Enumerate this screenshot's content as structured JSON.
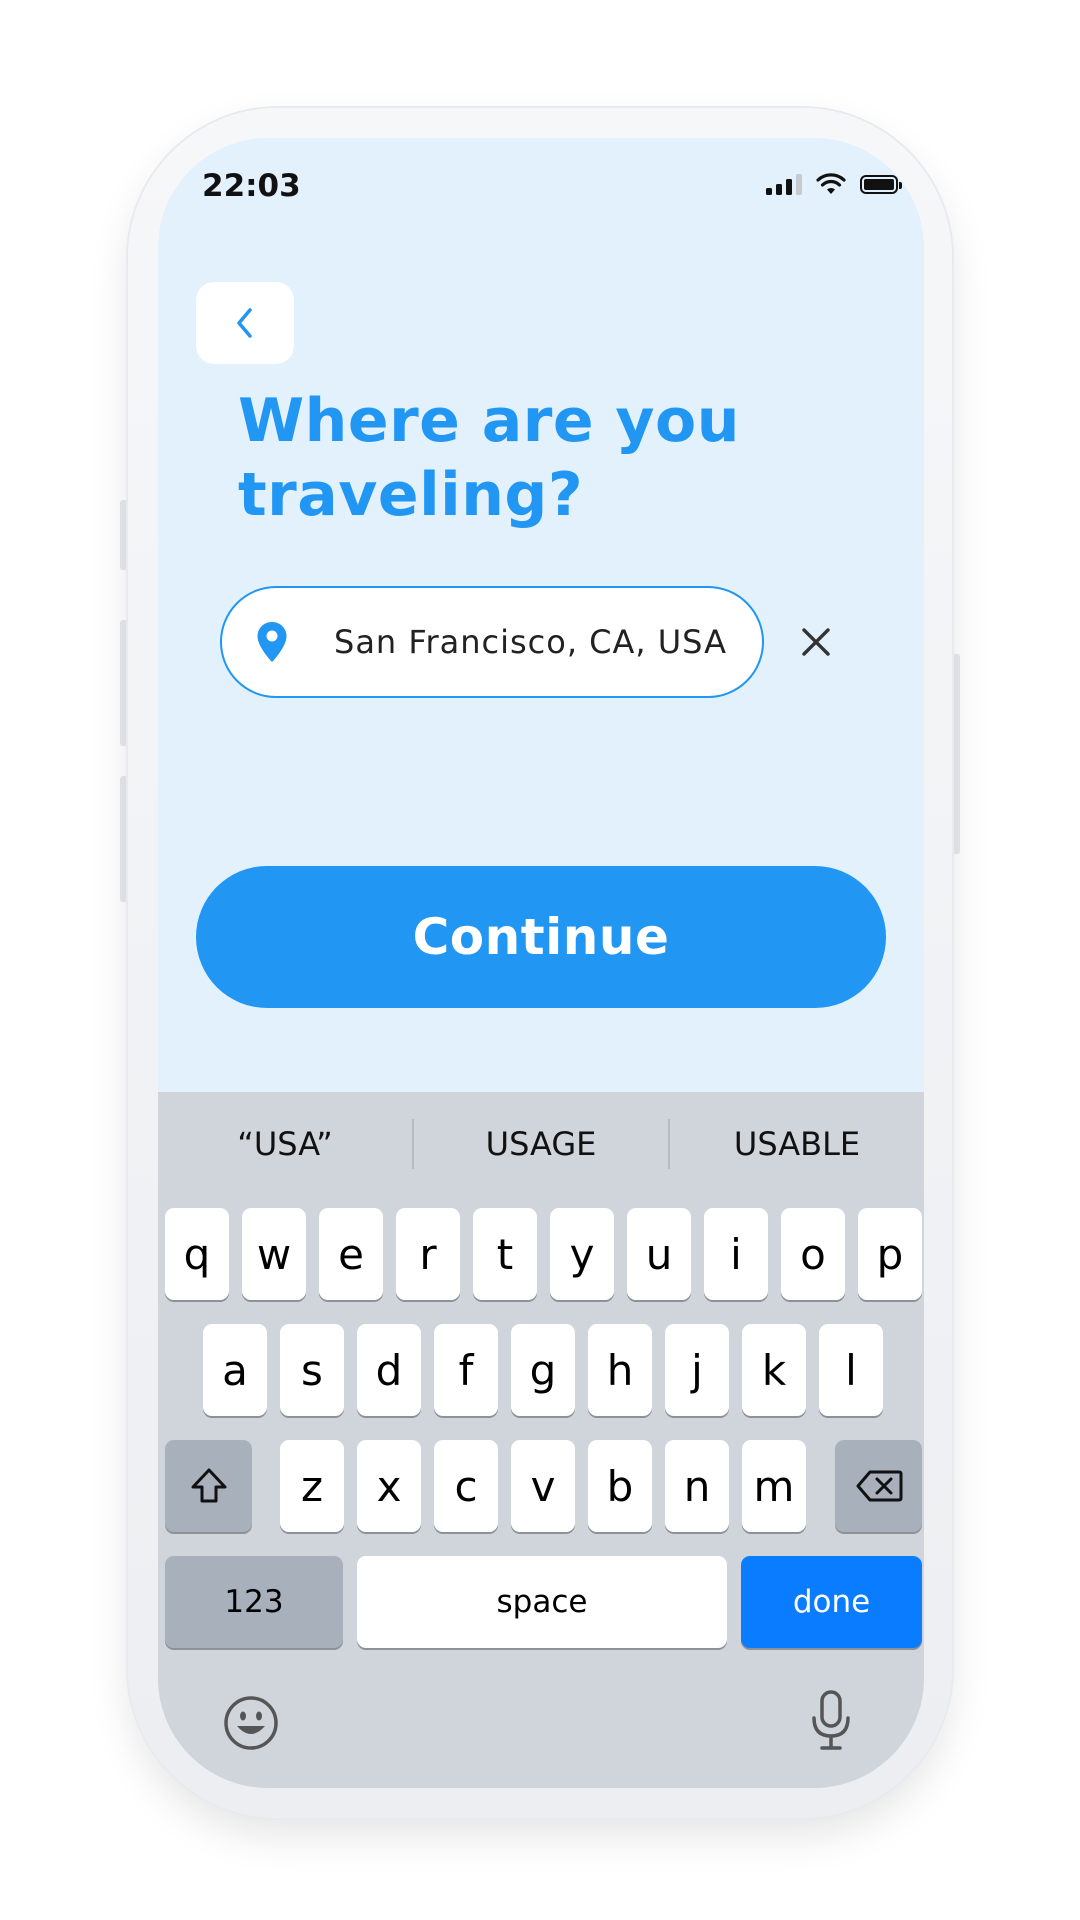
{
  "status_bar": {
    "time": "22:03"
  },
  "screen": {
    "title": "Where are you traveling?",
    "location_value": "San Francisco, CA, USA",
    "continue_label": "Continue"
  },
  "colors": {
    "accent": "#2196f3",
    "screen_bg": "#e3f1fd",
    "keyboard_bg": "#d0d5dc",
    "done_key": "#0a7cff"
  },
  "icons": {
    "back": "chevron-left-icon",
    "location": "location-pin-icon",
    "clear": "close-icon",
    "shift": "shift-icon",
    "delete": "backspace-icon",
    "emoji": "emoji-icon",
    "mic": "microphone-icon"
  },
  "keyboard": {
    "suggestions": [
      "“USA”",
      "USAGE",
      "USABLE"
    ],
    "row1": [
      "q",
      "w",
      "e",
      "r",
      "t",
      "y",
      "u",
      "i",
      "o",
      "p"
    ],
    "row2": [
      "a",
      "s",
      "d",
      "f",
      "g",
      "h",
      "j",
      "k",
      "l"
    ],
    "row3": [
      "z",
      "x",
      "c",
      "v",
      "b",
      "n",
      "m"
    ],
    "numbers_label": "123",
    "space_label": "space",
    "done_label": "done"
  }
}
